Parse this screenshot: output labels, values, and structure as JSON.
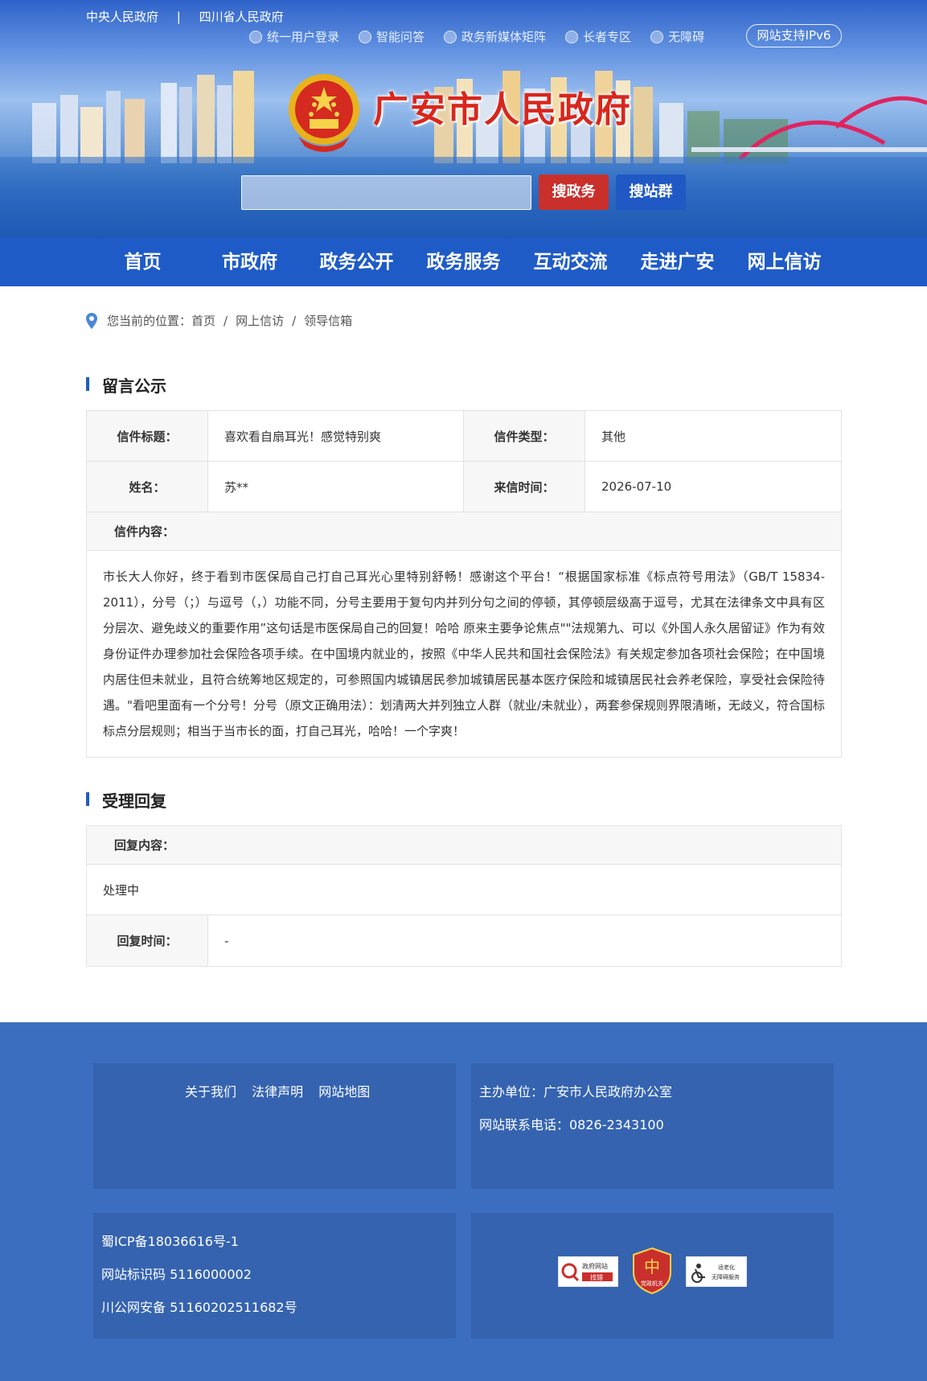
{
  "header": {
    "top_links": [
      "中央人民政府",
      "四川省人民政府"
    ],
    "top_sep": "|",
    "util_items": [
      {
        "label": "统一用户登录",
        "icon": "user-icon"
      },
      {
        "label": "智能问答",
        "icon": "robot-icon"
      },
      {
        "label": "政务新媒体矩阵",
        "icon": "media-icon"
      },
      {
        "label": "长者专区",
        "icon": "elder-icon"
      },
      {
        "label": "无障碍",
        "icon": "accessibility-icon"
      }
    ],
    "ipv6": "网站支持IPv6",
    "site_title": "广安市人民政府",
    "search_placeholder": "",
    "btn_search_gov": "搜政务",
    "btn_search_group": "搜站群"
  },
  "nav": [
    "首页",
    "市政府",
    "政务公开",
    "政务服务",
    "互动交流",
    "走进广安",
    "网上信访"
  ],
  "breadcrumb": {
    "prefix": "您当前的位置：",
    "items": [
      "首页",
      "网上信访",
      "领导信箱"
    ],
    "sep": "/"
  },
  "message": {
    "section_title": "留言公示",
    "title_label": "信件标题：",
    "title_value": "喜欢看自扇耳光！感觉特别爽",
    "type_label": "信件类型：",
    "type_value": "其他",
    "name_label": "姓名：",
    "name_value": "苏**",
    "time_label": "来信时间：",
    "time_value": "2026-07-10",
    "content_label": "信件内容：",
    "content": "市长大人你好，终于看到市医保局自己打自己耳光心里特别舒畅！感谢这个平台！“根据国家标准《标点符号用法》（GB/T 15834-2011），分号（；）与逗号（，）功能不同，分号主要用于复句内并列分句之间的停顿，其停顿层级高于逗号，尤其在法律条文中具有区分层次、避免歧义的重要作用”这句话是市医保局自己的回复！哈哈 原来主要争论焦点\"\"法规第九、可以《外国人永久居留证》作为有效身份证件办理参加社会保险各项手续。在中国境内就业的，按照《中华人民共和国社会保险法》有关规定参加各项社会保险；在中国境内居住但未就业，且符合统筹地区规定的，可参照国内城镇居民参加城镇居民基本医疗保险和城镇居民社会养老保险，享受社会保险待遇。\"看吧里面有一个分号！分号（原文正确用法）：划清两大并列独立人群（就业/未就业），两套参保规则界限清晰，无歧义，符合国标标点分层规则；相当于当市长的面，打自己耳光，哈哈！一个字爽！"
  },
  "reply": {
    "section_title": "受理回复",
    "content_label": "回复内容：",
    "content": "处理中",
    "time_label": "回复时间：",
    "time_value": "-"
  },
  "footer": {
    "links": [
      "关于我们",
      "法律声明",
      "网站地图"
    ],
    "sponsor": "主办单位：广安市人民政府办公室",
    "phone": "网站联系电话：0826-2343100",
    "icp": "蜀ICP备18036616号-1",
    "site_code": "网站标识码 5116000002",
    "police": "川公网安备 51160202511682号",
    "badges": [
      {
        "label": "政府网站找错",
        "icon": "find-error-badge"
      },
      {
        "label": "党政机关",
        "icon": "party-gov-badge"
      },
      {
        "label": "适老化无障碍服务",
        "icon": "elder-access-badge"
      }
    ],
    "badge_text_1a": "政府网站",
    "badge_text_1b": "找错",
    "badge_text_2": "党政机关",
    "badge_text_3a": "适老化",
    "badge_text_3b": "无障碍服务"
  },
  "colors": {
    "nav_bg": "#1f5bc6",
    "btn_gov": "#c9302c",
    "btn_group": "#2059c4",
    "footer_bg": "#3c6ebf",
    "title_red": "#d9261c"
  }
}
